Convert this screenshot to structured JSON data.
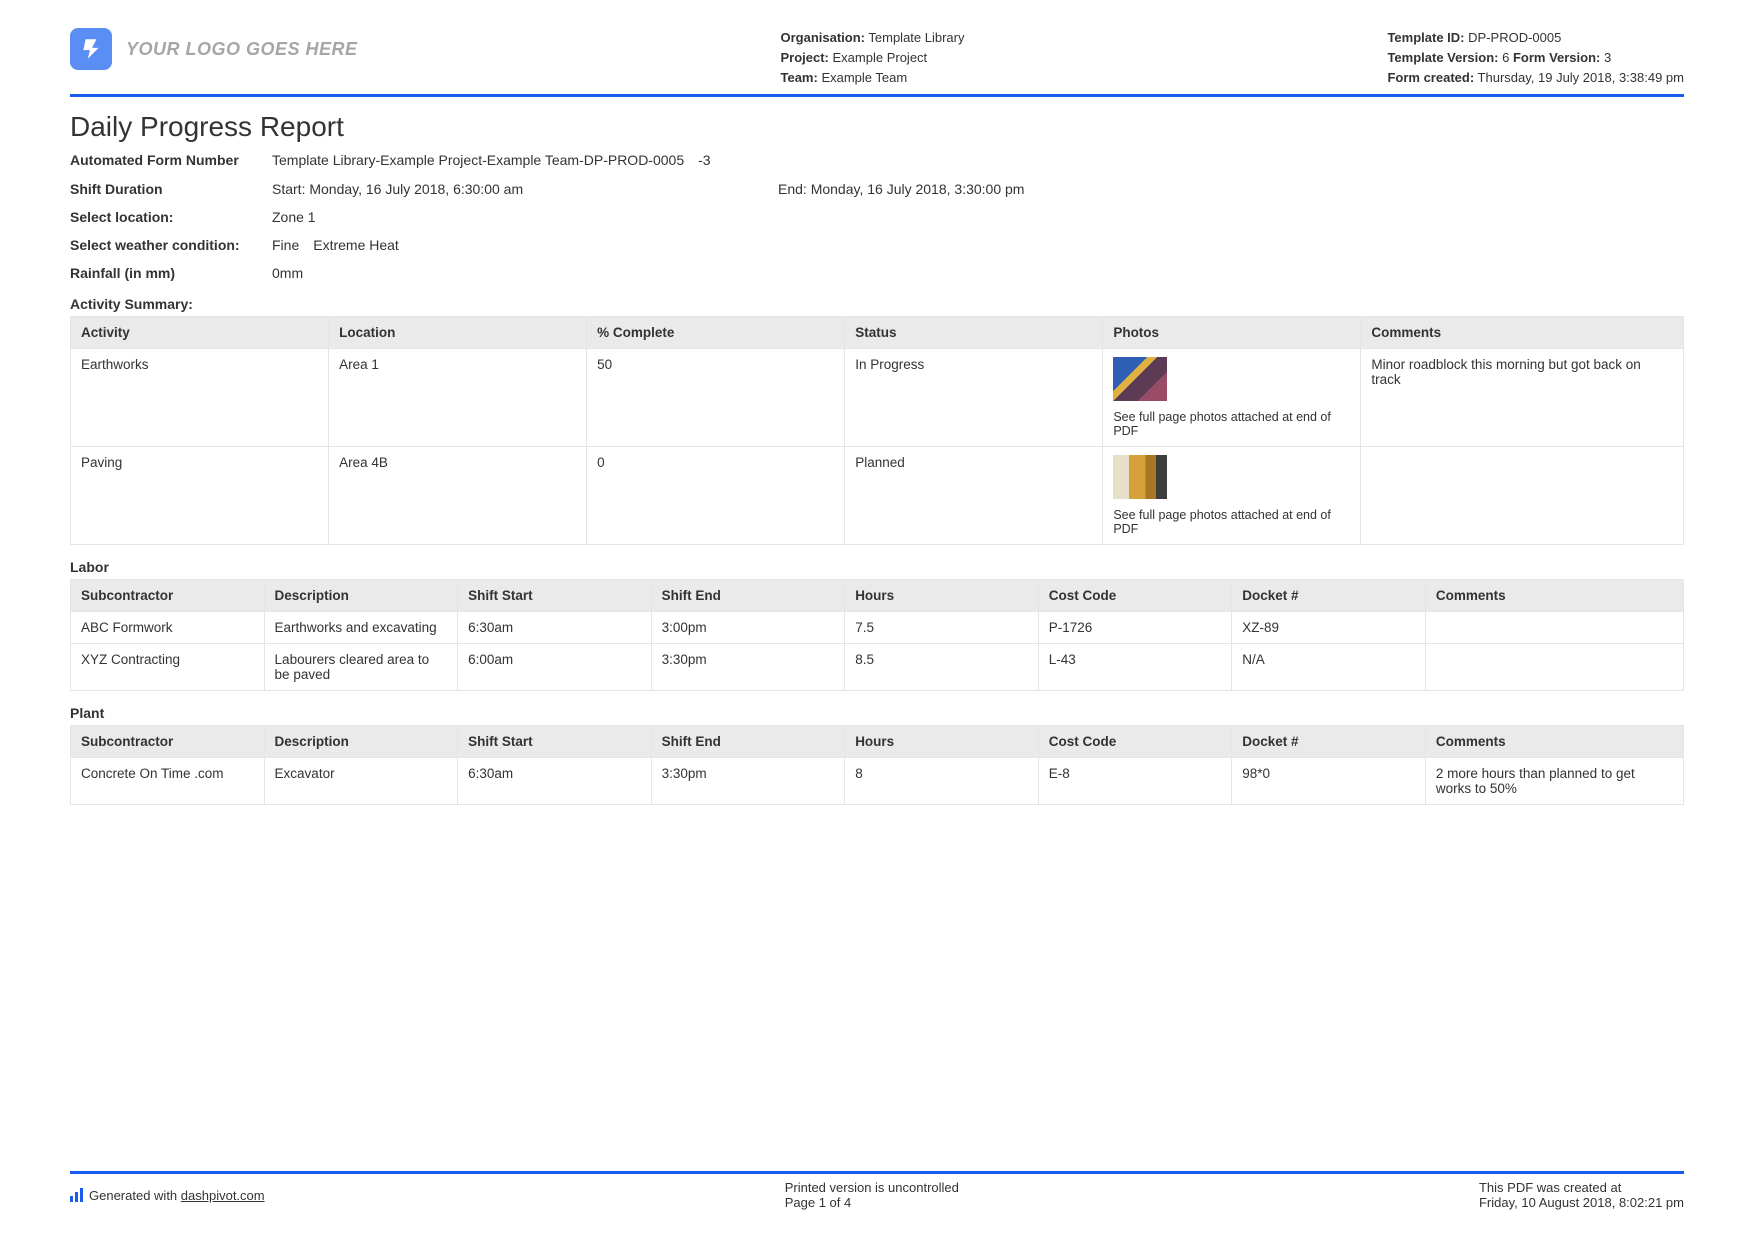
{
  "header": {
    "logo_text": "YOUR LOGO GOES HERE",
    "org_label": "Organisation:",
    "org_value": "Template Library",
    "project_label": "Project:",
    "project_value": "Example Project",
    "team_label": "Team:",
    "team_value": "Example Team",
    "template_id_label": "Template ID:",
    "template_id_value": "DP-PROD-0005",
    "template_version_label": "Template Version:",
    "template_version_value": "6",
    "form_version_label": "Form Version:",
    "form_version_value": "3",
    "form_created_label": "Form created:",
    "form_created_value": "Thursday, 19 July 2018, 3:38:49 pm"
  },
  "title": "Daily Progress Report",
  "fields": {
    "form_number_label": "Automated Form Number",
    "form_number_value": "Template Library-Example Project-Example Team-DP-PROD-0005 -3",
    "shift_label": "Shift Duration",
    "shift_start": "Start: Monday, 16 July 2018, 6:30:00 am",
    "shift_end": "End: Monday, 16 July 2018, 3:30:00 pm",
    "location_label": "Select location:",
    "location_value": "Zone 1",
    "weather_label": "Select weather condition:",
    "weather_value": "Fine Extreme Heat",
    "rainfall_label": "Rainfall (in mm)",
    "rainfall_value": "0mm"
  },
  "activity": {
    "title": "Activity Summary:",
    "headers": [
      "Activity",
      "Location",
      "% Complete",
      "Status",
      "Photos",
      "Comments"
    ],
    "photo_note": "See full page photos attached at end of PDF",
    "rows": [
      {
        "activity": "Earthworks",
        "location": "Area 1",
        "pct": "50",
        "status": "In Progress",
        "comments": "Minor roadblock this morning but got back on track"
      },
      {
        "activity": "Paving",
        "location": "Area 4B",
        "pct": "0",
        "status": "Planned",
        "comments": ""
      }
    ]
  },
  "labor": {
    "title": "Labor",
    "headers": [
      "Subcontractor",
      "Description",
      "Shift Start",
      "Shift End",
      "Hours",
      "Cost Code",
      "Docket #",
      "Comments"
    ],
    "rows": [
      {
        "sub": "ABC Formwork",
        "desc": "Earthworks and excavating",
        "start": "6:30am",
        "end": "3:00pm",
        "hours": "7.5",
        "cost": "P-1726",
        "docket": "XZ-89",
        "comments": ""
      },
      {
        "sub": "XYZ Contracting",
        "desc": "Labourers cleared area to be paved",
        "start": "6:00am",
        "end": "3:30pm",
        "hours": "8.5",
        "cost": "L-43",
        "docket": "N/A",
        "comments": ""
      }
    ]
  },
  "plant": {
    "title": "Plant",
    "headers": [
      "Subcontractor",
      "Description",
      "Shift Start",
      "Shift End",
      "Hours",
      "Cost Code",
      "Docket #",
      "Comments"
    ],
    "rows": [
      {
        "sub": "Concrete On Time .com",
        "desc": "Excavator",
        "start": "6:30am",
        "end": "3:30pm",
        "hours": "8",
        "cost": "E-8",
        "docket": "98*0",
        "comments": "2 more hours than planned to get works to 50%"
      }
    ]
  },
  "footer": {
    "generated_prefix": "Generated with ",
    "generated_link": "dashpivot.com",
    "uncontrolled": "Printed version is uncontrolled",
    "page": "Page 1 of 4",
    "created_at": "This PDF was created at",
    "created_date": "Friday, 10 August 2018, 8:02:21 pm"
  }
}
